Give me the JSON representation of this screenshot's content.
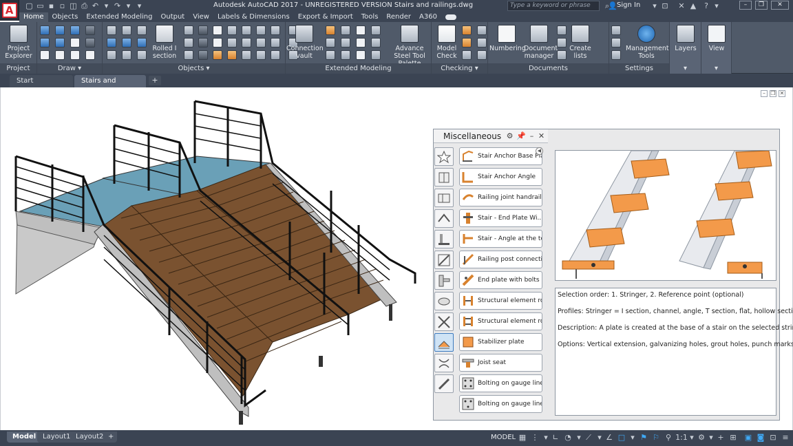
{
  "titlebar": {
    "title": "Autodesk AutoCAD 2017 - UNREGISTERED VERSION    Stairs and railings.dwg",
    "search_placeholder": "Type a keyword or phrase",
    "sign_in": "Sign In"
  },
  "ribbon_tabs": [
    "Home",
    "Objects",
    "Extended Modeling",
    "Output",
    "View",
    "Labels & Dimensions",
    "Export & Import",
    "Tools",
    "Render",
    "A360"
  ],
  "panels": {
    "project": {
      "title": "Project",
      "button": "Project Explorer"
    },
    "draw": {
      "title": "Draw"
    },
    "objects": {
      "title": "Objects",
      "rolled_section": "Rolled I section"
    },
    "extended": {
      "title": "Extended Modeling",
      "connection_vault": "Connection vault",
      "advance_steel": "Advance Steel Tool Palette"
    },
    "checking": {
      "title": "Checking",
      "model_check": "Model Check"
    },
    "documents": {
      "title": "Documents",
      "numbering": "Numbering",
      "doc_manager": "Document manager",
      "create_lists": "Create lists"
    },
    "settings": {
      "title": "Settings",
      "mgmt_tools": "Management Tools"
    },
    "layers": {
      "button": "Layers"
    },
    "view": {
      "button": "View"
    }
  },
  "doc_tabs": {
    "start": "Start",
    "active": "Stairs and railings*"
  },
  "palette": {
    "title": "Miscellaneous",
    "items": [
      "Stair Anchor Base Plate",
      "Stair Anchor Angle",
      "Railing joint handrail",
      "Stair - End Plate Wi...",
      "Stair - Angle at the top",
      "Railing post connection",
      "End plate with bolts",
      "Structural element ro...",
      "Structural element ro...",
      "Stabilizer plate",
      "Joist seat",
      "Bolting on gauge lines",
      "Bolting on gauge lines...."
    ],
    "description": [
      "Selection order: 1. Stringer, 2. Reference point (optional)",
      "Profiles: Stringer = I section, channel, angle, T section, flat, hollow sections",
      "Description: A plate is created at the base of a stair on the selected stringer.",
      "Options: Vertical extension, galvanizing holes, grout holes, punch marks"
    ]
  },
  "status": {
    "layout_tabs": [
      "Model",
      "Layout1",
      "Layout2"
    ],
    "model_label": "MODEL",
    "scale": "1:1"
  },
  "colors": {
    "accent": "#3fa9f5",
    "ribbon": "#505a69",
    "titlebar": "#3b4453",
    "wood": "#7a5230",
    "tread": "#f39a4a"
  }
}
